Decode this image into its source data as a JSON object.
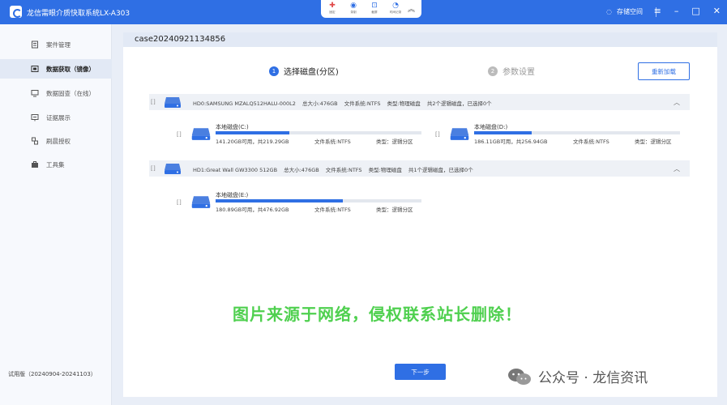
{
  "app": {
    "title": "龙信需眼介质快取系统LX-A303"
  },
  "quick_tools": [
    {
      "label": "固定",
      "icon": "pin-icon"
    },
    {
      "label": "录制",
      "icon": "record-icon"
    },
    {
      "label": "截屏",
      "icon": "crop-icon"
    },
    {
      "label": "时间记录",
      "icon": "clock-icon"
    }
  ],
  "header_right": {
    "storage_label": "存储空间"
  },
  "sidebar": {
    "items": [
      {
        "label": "案件管理",
        "icon": "case-icon",
        "active": false
      },
      {
        "label": "数据获取（镜像）",
        "icon": "disk-image-icon",
        "active": true
      },
      {
        "label": "数据固查（在线）",
        "icon": "monitor-icon",
        "active": false
      },
      {
        "label": "证据展示",
        "icon": "evidence-icon",
        "active": false
      },
      {
        "label": "刷晨授权",
        "icon": "license-icon",
        "active": false
      },
      {
        "label": "工具集",
        "icon": "toolbox-icon",
        "active": false
      }
    ],
    "version": "试用版（20240904-20241103）"
  },
  "case": {
    "title": "case20240921134856"
  },
  "steps": [
    {
      "num": "1",
      "label": "选择磁盘(分区)"
    },
    {
      "num": "2",
      "label": "参数设置"
    }
  ],
  "reload_button": "重新加载",
  "disks": [
    {
      "header": {
        "name": "HD0:SAMSUNG MZALQ512HALU-000L2",
        "total": "总大小:476GB",
        "fs": "文件系统:NTFS",
        "type": "类型:物理磁盘",
        "summary": "共2个逻辑磁盘，已选择0个"
      },
      "partitions": [
        {
          "name": "本地磁盘(C:)",
          "usage": "141.20GB可用，共219.29GB",
          "fs": "文件系统:NTFS",
          "type": "类型：逻辑分区",
          "used_fraction": 0.36
        },
        {
          "name": "本地磁盘(D:)",
          "usage": "186.11GB可用，共256.94GB",
          "fs": "文件系统:NTFS",
          "type": "类型：逻辑分区",
          "used_fraction": 0.28
        }
      ]
    },
    {
      "header": {
        "name": "HD1:Great Wall GW3300 512GB",
        "total": "总大小:476GB",
        "fs": "文件系统:NTFS",
        "type": "类型:物理磁盘",
        "summary": "共1个逻辑磁盘，已选择0个"
      },
      "partitions": [
        {
          "name": "本地磁盘(E:)",
          "usage": "180.89GB可用，共476.92GB",
          "fs": "文件系统:NTFS",
          "type": "类型：逻辑分区",
          "used_fraction": 0.62
        }
      ]
    }
  ],
  "next_button": "下一步",
  "watermark": "图片来源于网络，侵权联系站长删除！",
  "wechat_label": "公众号 · 龙信资讯",
  "colors": {
    "accent": "#2f6fe4",
    "watermark": "#4fd04f"
  }
}
